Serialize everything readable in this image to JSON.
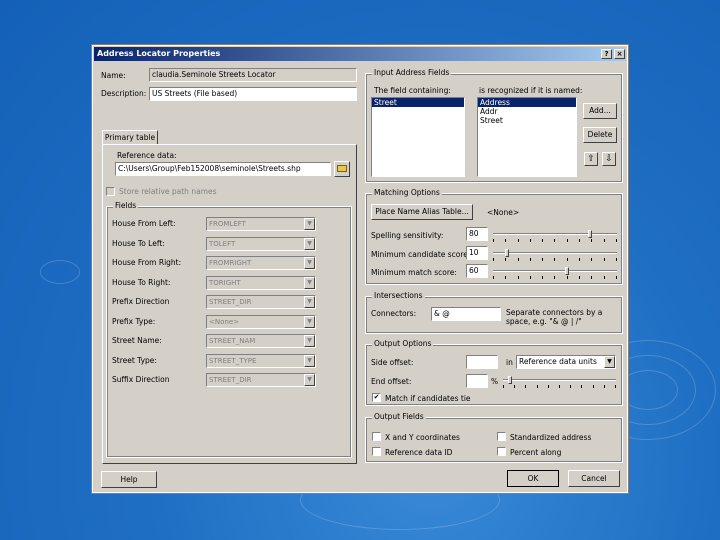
{
  "window": {
    "title": "Address Locator Properties",
    "help_btn": "?",
    "close_btn": "×"
  },
  "general": {
    "name_label": "Name:",
    "name_value": "claudia.Seminole Streets Locator",
    "description_label": "Description:",
    "description_value": "US Streets (File based)"
  },
  "tab": {
    "label": "Primary table"
  },
  "reference": {
    "label": "Reference data:",
    "value": "C:\\Users\\Group\\Feb152008\\seminole\\Streets.shp"
  },
  "store_relative": {
    "label": "Store relative path names"
  },
  "fields": {
    "title": "Fields",
    "rows": [
      {
        "label": "House From Left:",
        "value": "FROMLEFT"
      },
      {
        "label": "House To Left:",
        "value": "TOLEFT"
      },
      {
        "label": "House From Right:",
        "value": "FROMRIGHT"
      },
      {
        "label": "House To Right:",
        "value": "TORIGHT"
      },
      {
        "label": "Prefix Direction",
        "value": "STREET_DIR"
      },
      {
        "label": "Prefix Type:",
        "value": "<None>"
      },
      {
        "label": "Street Name:",
        "value": "STREET_NAM"
      },
      {
        "label": "Street Type:",
        "value": "STREET_TYPE"
      },
      {
        "label": "Suffix Direction",
        "value": "STREET_DIR"
      }
    ]
  },
  "input_address": {
    "title": "Input Address Fields",
    "col1_label": "The field containing:",
    "col2_label": "is recognized if it is named:",
    "list1": [
      "Street"
    ],
    "list2": [
      "Address",
      "Addr",
      "Street"
    ],
    "add_btn": "Add...",
    "delete_btn": "Delete",
    "up_icon": "⇧",
    "down_icon": "⇩"
  },
  "matching": {
    "title": "Matching Options",
    "place_alias_btn": "Place Name Alias Table...",
    "place_alias_value": "<None>",
    "spelling_label": "Spelling sensitivity:",
    "spelling_value": "80",
    "candidate_label": "Minimum candidate score:",
    "candidate_value": "10",
    "match_label": "Minimum match score:",
    "match_value": "60"
  },
  "intersections": {
    "title": "Intersections",
    "connectors_label": "Connectors:",
    "connectors_value": "& @",
    "hint": "Separate connectors by a space, e.g. \"& @ | /\""
  },
  "output_options": {
    "title": "Output Options",
    "side_offset_label": "Side offset:",
    "side_offset_value": "",
    "in_label": "in",
    "units_value": "Reference data units",
    "end_offset_label": "End offset:",
    "end_offset_value": "",
    "pct": "%",
    "match_ties_label": "Match if candidates tie"
  },
  "output_fields": {
    "title": "Output Fields",
    "xy": "X and Y coordinates",
    "standardized": "Standardized address",
    "ref_id": "Reference data ID",
    "percent_along": "Percent along"
  },
  "buttons": {
    "help": "Help",
    "ok": "OK",
    "cancel": "Cancel"
  }
}
